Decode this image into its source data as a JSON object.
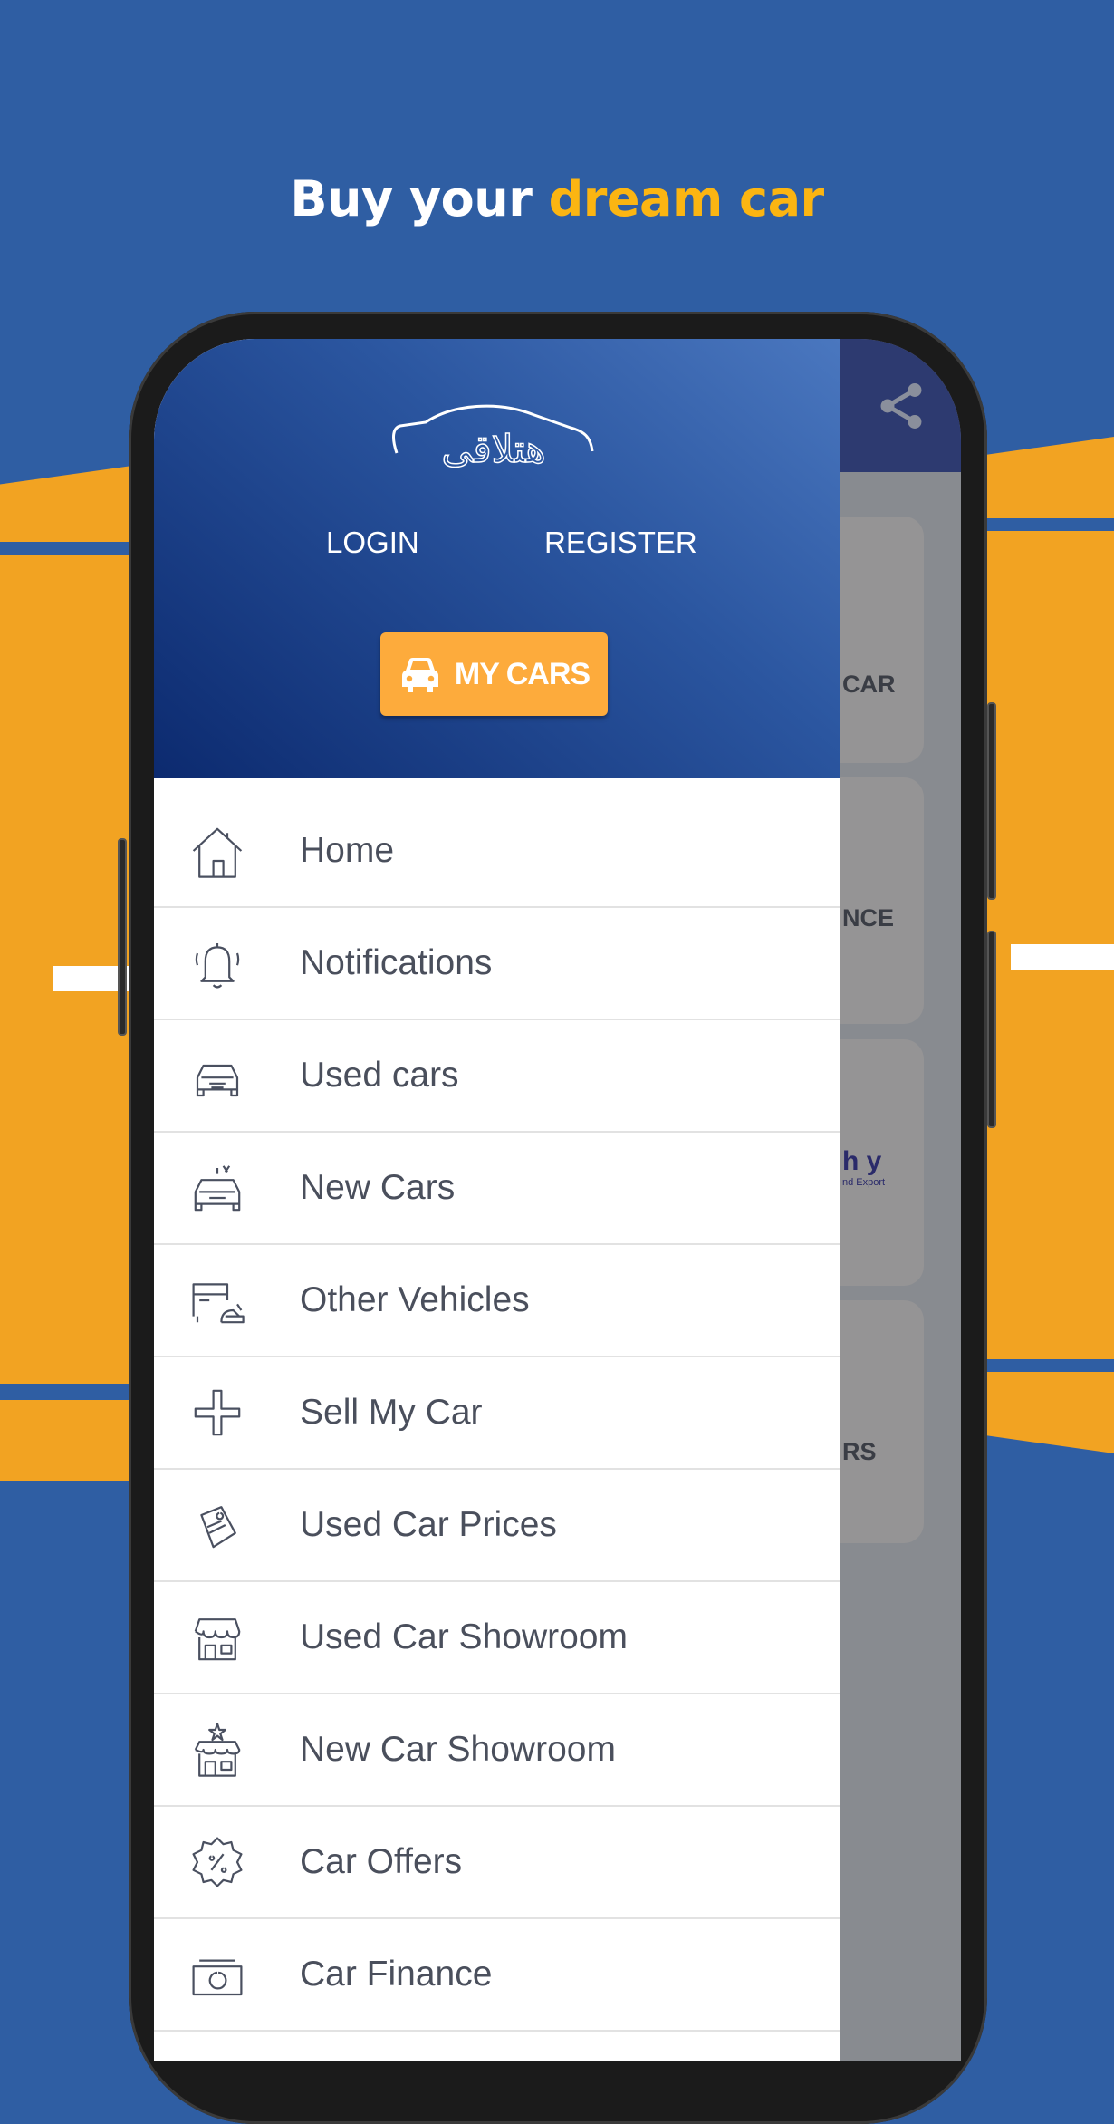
{
  "headline": {
    "part1": "Buy your ",
    "part2": "dream car"
  },
  "colors": {
    "background": "#2f5ea3",
    "accent_yellow": "#fbb512",
    "band_orange": "#f2a322",
    "button_orange": "#fdab3c",
    "appbar": "#2d3a70"
  },
  "app": {
    "logo_text": "هتلاقى",
    "share_icon": "share-icon",
    "drawer": {
      "login": "LOGIN",
      "register": "REGISTER",
      "my_cars": "MY CARS",
      "menu": [
        {
          "label": "Home",
          "icon": "home-icon"
        },
        {
          "label": "Notifications",
          "icon": "bell-icon"
        },
        {
          "label": "Used cars",
          "icon": "car-icon"
        },
        {
          "label": "New Cars",
          "icon": "new-car-icon"
        },
        {
          "label": "Other Vehicles",
          "icon": "vehicles-icon"
        },
        {
          "label": "Sell My Car",
          "icon": "plus-icon"
        },
        {
          "label": "Used Car Prices",
          "icon": "price-tag-icon"
        },
        {
          "label": "Used Car Showroom",
          "icon": "store-icon"
        },
        {
          "label": "New Car Showroom",
          "icon": "star-store-icon"
        },
        {
          "label": "Car Offers",
          "icon": "discount-badge-icon"
        },
        {
          "label": "Car Finance",
          "icon": "money-icon"
        }
      ]
    },
    "background_cards": [
      "CAR",
      "NCE",
      "h y",
      "nd Export",
      "RS"
    ]
  }
}
